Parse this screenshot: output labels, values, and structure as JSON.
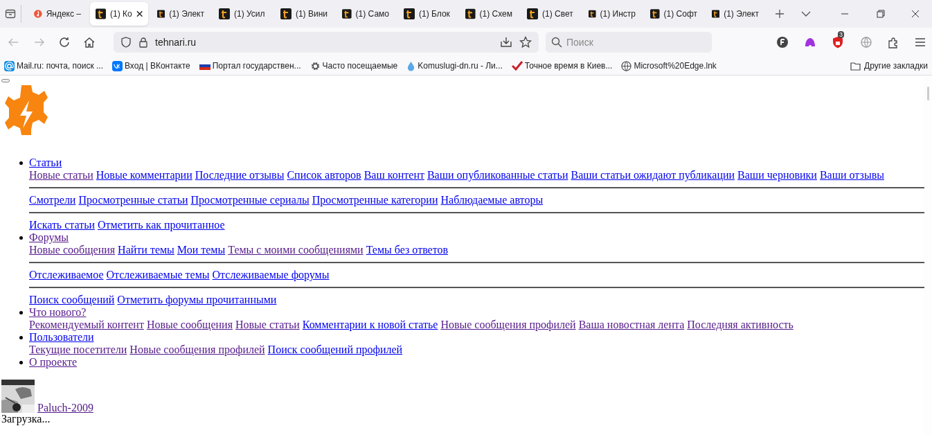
{
  "tabs": [
    {
      "label": "Яндекс –",
      "kind": "yandex",
      "selected": false
    },
    {
      "label": "(1) Ко",
      "kind": "site",
      "selected": true
    },
    {
      "label": "(1) Элект",
      "kind": "site",
      "selected": false
    },
    {
      "label": "(1) Усил",
      "kind": "site",
      "selected": false
    },
    {
      "label": "(1) Вини",
      "kind": "site",
      "selected": false
    },
    {
      "label": "(1) Само",
      "kind": "site",
      "selected": false
    },
    {
      "label": "(1) Блок",
      "kind": "site",
      "selected": false
    },
    {
      "label": "(1) Схем",
      "kind": "site",
      "selected": false
    },
    {
      "label": "(1) Свет",
      "kind": "site",
      "selected": false
    },
    {
      "label": "(1) Инстр",
      "kind": "site",
      "selected": false
    },
    {
      "label": "(1) Софт",
      "kind": "site",
      "selected": false
    },
    {
      "label": "(1) Элект",
      "kind": "site",
      "selected": false
    }
  ],
  "address": {
    "url": "tehnari.ru"
  },
  "search": {
    "placeholder": "Поиск"
  },
  "extensions": [
    {
      "kind": "f-circle"
    },
    {
      "kind": "purple"
    },
    {
      "kind": "shield",
      "badge": "3"
    },
    {
      "kind": "globe"
    },
    {
      "kind": "puzzle"
    }
  ],
  "bookmarks": [
    {
      "label": "Mail.ru: почта, поиск ...",
      "kind": "at"
    },
    {
      "label": "Вход | ВКонтакте",
      "kind": "vk"
    },
    {
      "label": "Портал государствен...",
      "kind": "flag"
    },
    {
      "label": "Часто посещаемые",
      "kind": "gear"
    },
    {
      "label": "Komuslugi-dn.ru - Ли...",
      "kind": "drop"
    },
    {
      "label": "Точное время в Киев...",
      "kind": "check"
    },
    {
      "label": "Microsoft%20Edge.lnk",
      "kind": "globe"
    }
  ],
  "other_bookmarks": "Другие закладки",
  "menu": [
    {
      "title": {
        "label": "Статьи",
        "visited": false
      },
      "groups": [
        [
          {
            "label": "Новые статьи",
            "visited": true
          },
          {
            "label": "Новые комментарии",
            "visited": false
          },
          {
            "label": "Последние отзывы",
            "visited": false
          },
          {
            "label": "Список авторов",
            "visited": false
          },
          {
            "label": "Ваш контент",
            "visited": false
          },
          {
            "label": "Ваши опубликованные статьи",
            "visited": false
          },
          {
            "label": "Ваши статьи ожидают публикации",
            "visited": false
          },
          {
            "label": "Ваши черновики",
            "visited": false
          },
          {
            "label": "Ваши отзывы",
            "visited": false
          }
        ],
        [
          {
            "label": "Смотрели",
            "visited": false
          },
          {
            "label": "Просмотренные статьи",
            "visited": false
          },
          {
            "label": "Просмотренные сериалы",
            "visited": false
          },
          {
            "label": "Просмотренные категории",
            "visited": false
          },
          {
            "label": "Наблюдаемые авторы",
            "visited": false
          }
        ],
        [
          {
            "label": "Искать статьи",
            "visited": false
          },
          {
            "label": "Отметить как прочитанное",
            "visited": false
          }
        ]
      ]
    },
    {
      "title": {
        "label": "Форумы",
        "visited": true
      },
      "groups": [
        [
          {
            "label": "Новые сообщения",
            "visited": true
          },
          {
            "label": "Найти темы",
            "visited": false
          },
          {
            "label": "Мои темы",
            "visited": false
          },
          {
            "label": "Темы с моими сообщениями",
            "visited": true
          },
          {
            "label": "Темы без ответов",
            "visited": false
          }
        ],
        [
          {
            "label": "Отслеживаемое",
            "visited": false
          },
          {
            "label": "Отслеживаемые темы",
            "visited": false
          },
          {
            "label": "Отслеживаемые форумы",
            "visited": false
          }
        ],
        [
          {
            "label": "Поиск сообщений",
            "visited": false
          },
          {
            "label": "Отметить форумы прочитанными",
            "visited": false
          }
        ]
      ]
    },
    {
      "title": {
        "label": "Что нового?",
        "visited": true
      },
      "groups": [
        [
          {
            "label": "Рекомендуемый контент",
            "visited": true
          },
          {
            "label": "Новые сообщения",
            "visited": true
          },
          {
            "label": "Новые статьи",
            "visited": true
          },
          {
            "label": "Комментарии к новой статье",
            "visited": false
          },
          {
            "label": "Новые сообщения профилей",
            "visited": true
          },
          {
            "label": "Ваша новостная лента",
            "visited": true
          },
          {
            "label": "Последняя активность",
            "visited": true
          }
        ]
      ]
    },
    {
      "title": {
        "label": "Пользователи",
        "visited": false
      },
      "groups": [
        [
          {
            "label": "Текущие посетители",
            "visited": true
          },
          {
            "label": "Новые сообщения профилей",
            "visited": true
          },
          {
            "label": "Поиск сообщений профилей",
            "visited": false
          }
        ]
      ]
    },
    {
      "title": {
        "label": "О проекте",
        "visited": true
      }
    }
  ],
  "user": {
    "name": "Paluch-2009",
    "visited": true
  },
  "loading": "Загрузка..."
}
